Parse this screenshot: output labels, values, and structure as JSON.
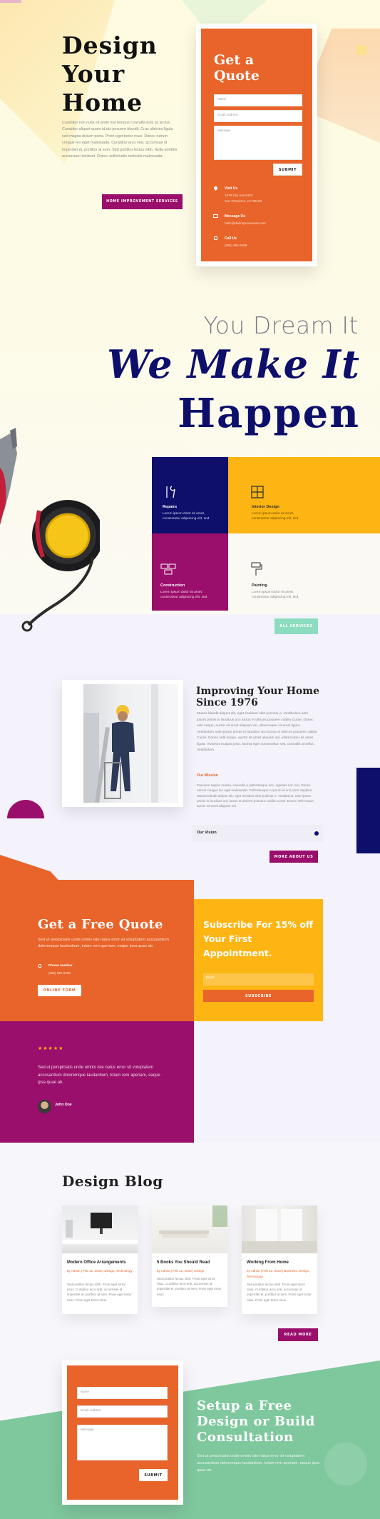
{
  "hero": {
    "title_line1": "Design",
    "title_line2": "Your",
    "title_line3": "Home",
    "body": "Curabitur non nulla sit amet nisl tempus convallis quis ac lectus. Curabitur aliquet quam id dui posuere blandit. Cras ultricies ligula sed magna dictum porta. Proin eget tortor risus. Donec rutrum congue leo eget malesuada. Curabitur arcu erat, accumsan id imperdiet et, porttitor at sem. Sed porttitor lectus nibh. Nulla porttitor accumsan tincidunt. Donec sollicitudin molestie malesuada.",
    "button_label": "Home Improvement Services"
  },
  "quote_card": {
    "title_line1": "Get a",
    "title_line2": "Quote",
    "name_placeholder": "Name",
    "email_placeholder": "Email Address",
    "message_placeholder": "Message",
    "submit_label": "Submit",
    "visit_label": "Visit Us",
    "visit_line1": "1878 Divi Ave #123",
    "visit_line2": "San Francisco, CA 90123",
    "message_label": "Message Us",
    "message_value": "hello@diviimprovement.com",
    "call_label": "Call Us",
    "call_value": "(255) 352-6258"
  },
  "tagline": {
    "line1": "You Dream It",
    "line2": "We Make It",
    "line3": "Happen"
  },
  "services": [
    {
      "title": "Repairs",
      "text": "Lorem ipsum dolor sit amet, consectetur adipiscing elit, sed.",
      "icon": "tools-icon"
    },
    {
      "title": "Interior Design",
      "text": "Lorem ipsum dolor sit amet, consectetur adipiscing elit, sed.",
      "icon": "layout-icon"
    },
    {
      "title": "Construction",
      "text": "Lorem ipsum dolor sit amet, consectetur adipiscing elit, sed.",
      "icon": "bricks-icon"
    },
    {
      "title": "Painting",
      "text": "Lorem ipsum dolor sit amet, consectetur adipiscing elit, sed.",
      "icon": "paint-roller-icon"
    }
  ],
  "all_services_label": "All Services",
  "about": {
    "title_line1": "Improving Your Home",
    "title_line2": "Since 1976",
    "body": "Mauris blandit aliquet elit, eget tincidunt nibh pulvinar a. Vestibulum ante ipsum primis in faucibus orci luctus et ultrices posuere cubilia Curae; Donec velit neque, auctor sit amet aliquam vel, ullamcorper sit amet ligula. Vestibulum ante ipsum primis in faucibus orci luctus et ultrices posuere cubilia Curae; Donec velit neque, auctor sit amet aliquam vel, ullamcorper sit amet ligula. Vivamus magna justo, lacinia eget consectetur sed, convallis at tellus. Vestibulum.",
    "mission_label": "Our Mission",
    "mission_text": "Praesent sapien massa, convallis a pellentesque nec, egestas non nisi. Donec rutrum congue leo eget malesuada. Pellentesque in ipsum id orci porta dapibus. Mauris blandit aliquet elit, eget tincidunt nibh pulvinar a. Vestibulum ante ipsum primis in faucibus orci luctus et ultrices posuere cubilia Curae; Donec velit neque, auctor sit amet aliquam vel.",
    "vision_label": "Our Vision",
    "more_label": "More About Us"
  },
  "free_quote": {
    "title": "Get a Free Quote",
    "text": "Sed ut perspiciatis unde omnis iste natus error sit voluptatem accusantium doloremque laudantium, totam rem aperiam, eaque ipsa quae ab.",
    "phone_label": "Phone number",
    "phone_value": "(255) 352-6258",
    "button_label": "Online Form"
  },
  "subscribe": {
    "title": "Subscribe For 15% off Your First Appointment.",
    "email_placeholder": "Email",
    "button_label": "Subscribe"
  },
  "testimonial": {
    "stars": "★★★★★",
    "text": "Sed ut perspiciatis unde omnis iste natus error sit voluptatem accusantium doloremque laudantium, totam rem aperiam, eaque ipsa quae ab.",
    "author": "John Doe"
  },
  "blog": {
    "title": "Design Blog",
    "posts": [
      {
        "title": "Modern Office Arrangements",
        "meta": "by Admin | Feb 12, 2019 | Design, Technology",
        "excerpt": "Sed porttitor lectus nibh. Proin eget tortor risus. Curabitur arcu erat, accumsan id imperdiet et, porttitor at sem. Proin eget tortor risus. Proin eget tortor risus."
      },
      {
        "title": "5 Books You Should Read",
        "meta": "by Admin | Feb 12, 2019 | Design",
        "excerpt": "Sed porttitor lectus nibh. Proin eget tortor risus. Curabitur arcu erat, accumsan id imperdiet et, porttitor at sem. Proin eget tortor risus."
      },
      {
        "title": "Working From Home",
        "meta": "by Admin | Feb 12, 2019 | Business, Design, Technology",
        "excerpt": "Sed porttitor lectus nibh. Proin eget tortor risus. Curabitur arcu erat, accumsan id imperdiet et, porttitor at sem. Proin eget tortor risus. Proin eget tortor risus."
      }
    ],
    "read_more_label": "Read More"
  },
  "consult": {
    "name_placeholder": "Name",
    "email_placeholder": "Email Address",
    "message_placeholder": "Message",
    "submit_label": "Submit",
    "title_line1": "Setup a Free",
    "title_line2": "Design or Build",
    "title_line3": "Consultation",
    "text": "Sed ut perspiciatis unde omnis iste natus error sit voluptatem accusantium doloremque laudantium, totam rem aperiam, eaque ipsa quae ab."
  },
  "colors": {
    "orange": "#e8642a",
    "navy": "#0d0f6b",
    "purple": "#9a0f6b",
    "yellow": "#fdb514",
    "mint": "#8cdcc0",
    "green": "#7fc89e"
  }
}
